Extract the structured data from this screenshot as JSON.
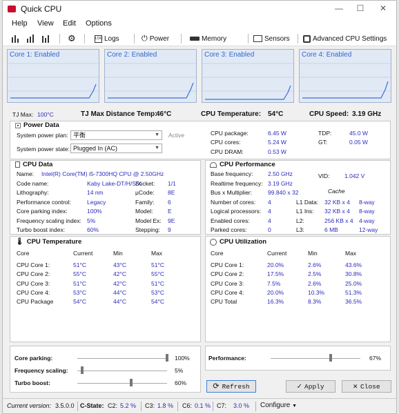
{
  "window": {
    "title": "Quick CPU"
  },
  "menu": [
    "Help",
    "View",
    "Edit",
    "Options"
  ],
  "toolbar": {
    "logs": "Logs",
    "power": "Power",
    "memory": "Memory",
    "sensors": "Sensors",
    "advanced": "Advanced CPU Settings"
  },
  "cores": [
    {
      "label": "Core 1: Enabled"
    },
    {
      "label": "Core 2: Enabled"
    },
    {
      "label": "Core 3: Enabled"
    },
    {
      "label": "Core 4: Enabled"
    }
  ],
  "info_row": {
    "tjmax_label": "TJ Max:",
    "tjmax_value": "100°C",
    "tjdist_label": "TJ Max Distance Temp:",
    "tjdist_value": "46°C",
    "cputemp_label": "CPU Temperature:",
    "cputemp_value": "54°C",
    "cpuspeed_label": "CPU Speed:",
    "cpuspeed_value": "3.19 GHz"
  },
  "power_data": {
    "title": "Power Data",
    "plan_label": "System power plan:",
    "plan_value": "平衡",
    "plan_status": "Active",
    "state_label": "System power state:",
    "state_value": "Plugged In (AC)",
    "package_label": "CPU package:",
    "package_value": "6.45 W",
    "cores_label": "CPU cores:",
    "cores_value": "5.24 W",
    "dram_label": "CPU DRAM:",
    "dram_value": "0.53 W",
    "tdp_label": "TDP:",
    "tdp_value": "45.0 W",
    "gt_label": "GT:",
    "gt_value": "0.05 W"
  },
  "cpu_data": {
    "title": "CPU Data",
    "name_label": "Name:",
    "name_value": "Intel(R) Core(TM) i5-7300HQ CPU @ 2.50GHz",
    "rows_left": [
      {
        "label": "Code name:",
        "value": "Kaby Lake-DT/H/S/X"
      },
      {
        "label": "Lithography:",
        "value": "14 nm"
      },
      {
        "label": "Performance control:",
        "value": "Legacy"
      },
      {
        "label": "Core parking index:",
        "value": "100%"
      },
      {
        "label": "Frequency scaling index:",
        "value": "5%"
      },
      {
        "label": "Turbo boost index:",
        "value": "60%"
      }
    ],
    "rows_right": [
      {
        "label": "Socket:",
        "value": "1/1"
      },
      {
        "label": "µCode:",
        "value": "8E"
      },
      {
        "label": "Family:",
        "value": "6"
      },
      {
        "label": "Model:",
        "value": "E"
      },
      {
        "label": "Model Ex:",
        "value": "9E"
      },
      {
        "label": "Stepping:",
        "value": "9"
      }
    ]
  },
  "cpu_perf": {
    "title": "CPU Performance",
    "rows": [
      {
        "label": "Base frequency:",
        "value": "2.50 GHz"
      },
      {
        "label": "Realtime frequency:",
        "value": "3.19 GHz"
      },
      {
        "label": "Bus x Multiplier:",
        "value": "99.840 x 32"
      },
      {
        "label": "Number of cores:",
        "value": "4"
      },
      {
        "label": "Logical processors:",
        "value": "4"
      },
      {
        "label": "Enabled cores:",
        "value": "4"
      },
      {
        "label": "Parked cores:",
        "value": "0"
      }
    ],
    "vid_label": "VID:",
    "vid_value": "1.042 V",
    "cache_label": "Cache",
    "cache": [
      {
        "label": "L1 Data:",
        "size": "32 KB x 4",
        "way": "8-way"
      },
      {
        "label": "L1 Ins:",
        "size": "32 KB x 4",
        "way": "8-way"
      },
      {
        "label": "L2:",
        "size": "256 KB x 4",
        "way": "4-way"
      },
      {
        "label": "L3:",
        "size": "6 MB",
        "way": "12-way"
      }
    ]
  },
  "cpu_temp": {
    "title": "CPU Temperature",
    "headers": [
      "Core",
      "Current",
      "Min",
      "Max"
    ],
    "rows": [
      [
        "CPU Core 1:",
        "51°C",
        "43°C",
        "51°C"
      ],
      [
        "CPU Core 2:",
        "55°C",
        "42°C",
        "55°C"
      ],
      [
        "CPU Core 3:",
        "51°C",
        "42°C",
        "51°C"
      ],
      [
        "CPU Core 4:",
        "53°C",
        "44°C",
        "53°C"
      ],
      [
        "CPU Package",
        "54°C",
        "44°C",
        "54°C"
      ]
    ]
  },
  "cpu_util": {
    "title": "CPU Utilization",
    "headers": [
      "Core",
      "Current",
      "Min",
      "Max"
    ],
    "rows": [
      [
        "CPU Core 1:",
        "20.0%",
        "2.6%",
        "43.6%"
      ],
      [
        "CPU Core 2:",
        "17.5%",
        "2.5%",
        "30.8%"
      ],
      [
        "CPU Core 3:",
        "7.5%",
        "2.6%",
        "25.0%"
      ],
      [
        "CPU Core 4:",
        "20.0%",
        "10.3%",
        "51.3%"
      ],
      [
        "CPU Total",
        "16.3%",
        "8.3%",
        "36.5%"
      ]
    ]
  },
  "sliders": {
    "core_parking": {
      "label": "Core parking:",
      "value": "100%",
      "level": 1.0
    },
    "freq_scaling": {
      "label": "Frequency scaling:",
      "value": "5%",
      "level": 0.05
    },
    "turbo_boost": {
      "label": "Turbo boost:",
      "value": "60%",
      "level": 0.6
    },
    "performance": {
      "label": "Performance:",
      "value": "67%",
      "level": 0.67
    }
  },
  "buttons": {
    "refresh": "Refresh",
    "apply": "Apply",
    "close": "Close"
  },
  "status": {
    "version_label": "Current version:",
    "version_value": "3.5.0.0",
    "cstate_label": "C-State:",
    "c2_label": "C2:",
    "c2_value": "5.2 %",
    "c3_label": "C3:",
    "c3_value": "1.8 %",
    "c6_label": "C6:",
    "c6_value": "0.1 %",
    "c7_label": "C7:",
    "c7_value": "3.0 %",
    "configure": "Configure"
  }
}
